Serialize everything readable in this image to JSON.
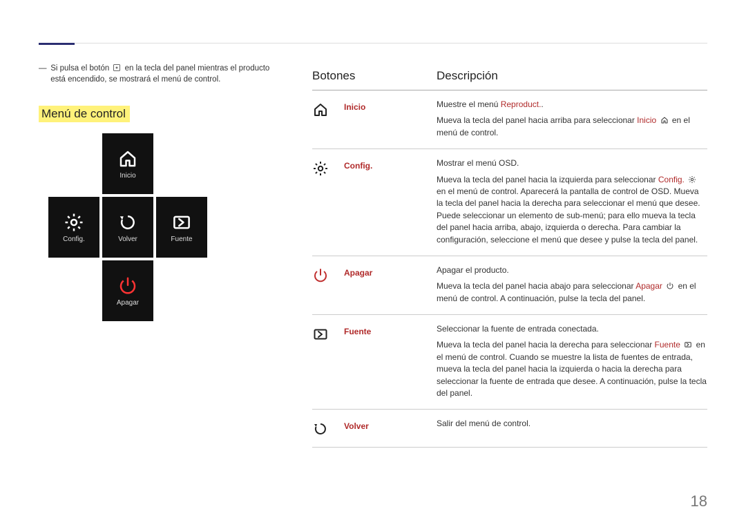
{
  "page_number": "18",
  "note": {
    "prefix": "Si pulsa el botón ",
    "suffix": " en la tecla del panel mientras el producto está encendido, se mostrará el menú de control."
  },
  "control_menu_heading": "Menú de control",
  "dpad": {
    "top": "Inicio",
    "left": "Config.",
    "center": "Volver",
    "right": "Fuente",
    "bottom": "Apagar"
  },
  "table": {
    "header": {
      "buttons": "Botones",
      "description": "Descripción"
    },
    "rows": {
      "inicio": {
        "name": "Inicio",
        "lead_prefix": "Muestre el menú ",
        "lead_accent": "Reproduct.",
        "lead_suffix": ".",
        "body_prefix": "Mueva la tecla del panel hacia arriba para seleccionar ",
        "body_accent": "Inicio",
        "body_mid": " ",
        "body_suffix": " en el menú de control."
      },
      "config": {
        "name": "Config.",
        "lead": "Mostrar el menú OSD.",
        "body_prefix": "Mueva la tecla del panel hacia la izquierda para seleccionar ",
        "body_accent": "Config.",
        "body_mid": " ",
        "body_suffix": " en el menú de control. Aparecerá la pantalla de control de OSD. Mueva la tecla del panel hacia la derecha para seleccionar el menú que desee. Puede seleccionar un elemento de sub-menú; para ello mueva la tecla del panel hacia arriba, abajo, izquierda o derecha. Para cambiar la configuración, seleccione el menú que desee y pulse la tecla del panel."
      },
      "apagar": {
        "name": "Apagar",
        "lead": "Apagar el producto.",
        "body_prefix": "Mueva la tecla del panel hacia abajo para seleccionar ",
        "body_accent": "Apagar",
        "body_mid": " ",
        "body_suffix": " en el menú de control. A continuación, pulse la tecla del panel."
      },
      "fuente": {
        "name": "Fuente",
        "lead": "Seleccionar la fuente de entrada conectada.",
        "body_prefix": "Mueva la tecla del panel hacia la derecha para seleccionar ",
        "body_accent": "Fuente",
        "body_mid": " ",
        "body_suffix": " en el menú de control. Cuando se muestre la lista de fuentes de entrada, mueva la tecla del panel hacia la izquierda o hacia la derecha para seleccionar la fuente de entrada que desee. A continuación, pulse la tecla del panel."
      },
      "volver": {
        "name": "Volver",
        "body": "Salir del menú de control."
      }
    }
  }
}
